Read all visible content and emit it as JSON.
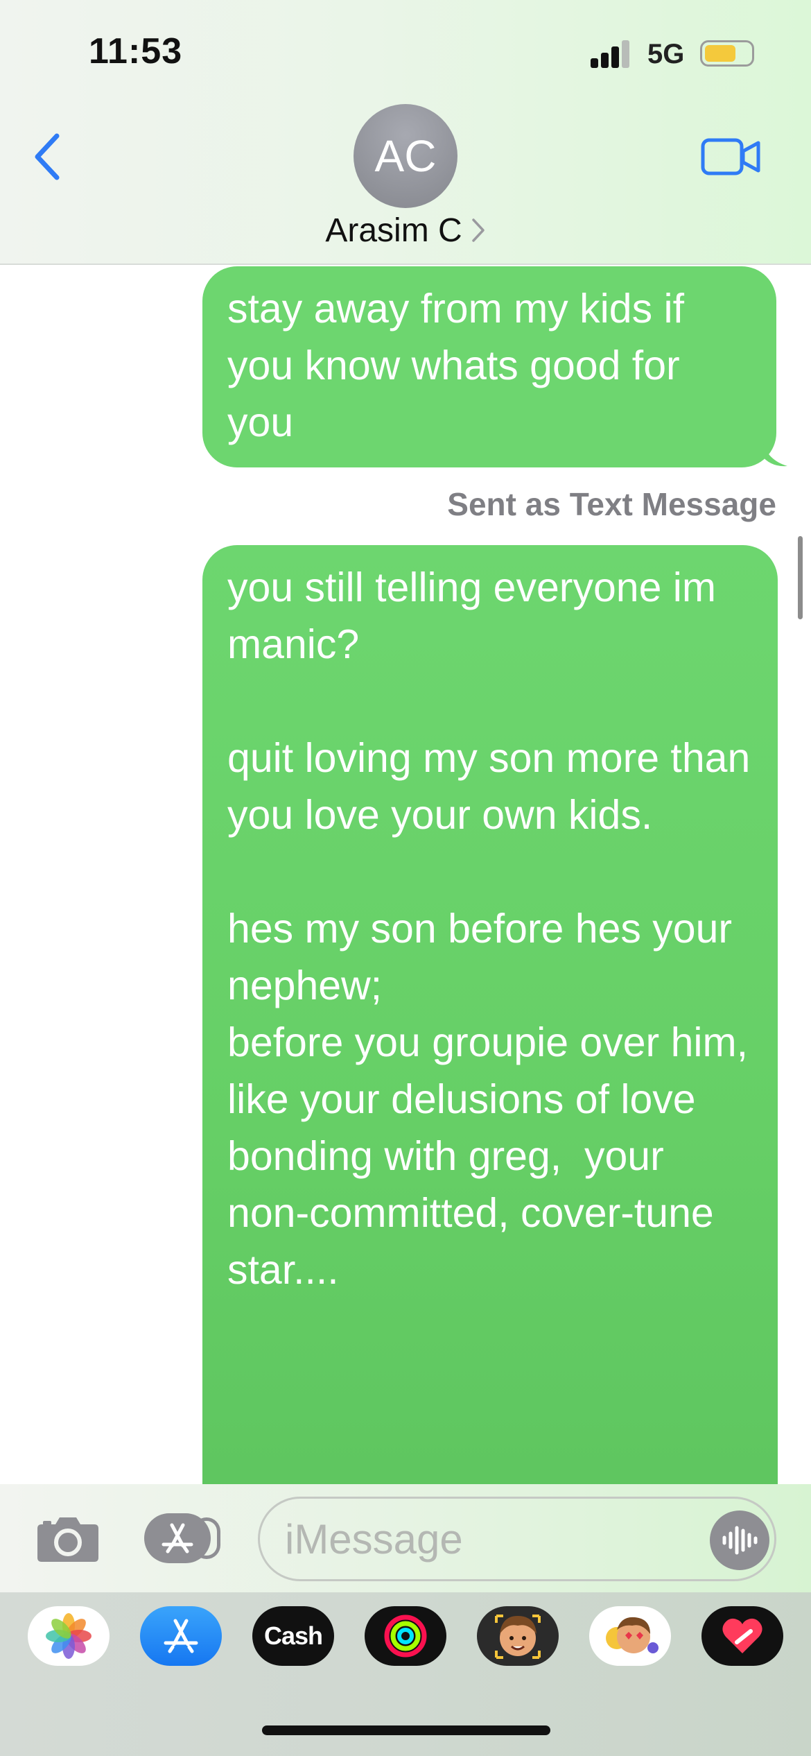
{
  "status_bar": {
    "time": "11:53",
    "network": "5G",
    "battery_level": 0.6,
    "battery_color": "#f4c93c"
  },
  "header": {
    "avatar_initials": "AC",
    "contact_name": "Arasim C"
  },
  "messages": [
    {
      "direction": "outgoing",
      "text": "stay away from my kids if you know whats good for you"
    },
    {
      "direction": "outgoing",
      "text": "you still telling everyone im manic?\n\nquit loving my son more than you love your own kids.\n\nhes my son before hes your nephew;\nbefore you groupie over him, like your delusions of love bonding with greg,  your non-committed, cover-tune star...."
    }
  ],
  "sent_note": "Sent as Text Message",
  "input": {
    "placeholder": "iMessage"
  },
  "app_drawer": {
    "apps": [
      "photos-icon",
      "app-store-icon",
      "Cash",
      "fitness-icon",
      "memoji-icon",
      "stickers-icon",
      "digital-touch-icon"
    ],
    "cash_label": "Cash"
  },
  "colors": {
    "bubble": "#6dd66f",
    "accent": "#2f7bf5",
    "secondary_text": "#7f7f84"
  }
}
